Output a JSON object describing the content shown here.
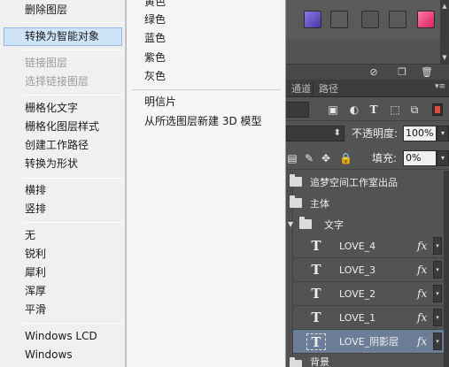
{
  "context_menu": {
    "items": [
      {
        "label": "删除图层",
        "disabled": false
      },
      {
        "label": "转换为智能对象",
        "disabled": false,
        "highlighted": true
      },
      {
        "label": "链接图层",
        "disabled": true
      },
      {
        "label": "选择链接图层",
        "disabled": true
      },
      {
        "label": "栅格化文字",
        "disabled": false
      },
      {
        "label": "栅格化图层样式",
        "disabled": false
      },
      {
        "label": "创建工作路径",
        "disabled": false
      },
      {
        "label": "转换为形状",
        "disabled": false
      },
      {
        "label": "横排",
        "disabled": false
      },
      {
        "label": "竖排",
        "disabled": false
      },
      {
        "label": "无",
        "disabled": false
      },
      {
        "label": "锐利",
        "disabled": false
      },
      {
        "label": "犀利",
        "disabled": false
      },
      {
        "label": "浑厚",
        "disabled": false
      },
      {
        "label": "平滑",
        "disabled": false
      },
      {
        "label": "Windows LCD",
        "disabled": false
      },
      {
        "label": "Windows",
        "disabled": false
      }
    ]
  },
  "submenu": {
    "items": [
      {
        "label": "黄色"
      },
      {
        "label": "绿色"
      },
      {
        "label": "蓝色"
      },
      {
        "label": "紫色"
      },
      {
        "label": "灰色"
      },
      {
        "label": "明信片"
      },
      {
        "label": "从所选图层新建 3D 模型"
      }
    ]
  },
  "panel": {
    "tabs": [
      {
        "label": "通道"
      },
      {
        "label": "路径"
      }
    ],
    "opacity_label": "不透明度:",
    "opacity_value": "100%",
    "fill_label": "填充:",
    "fill_value": "0%",
    "layers": [
      {
        "name": "追梦空间工作室出品",
        "kind": "group"
      },
      {
        "name": "主体",
        "kind": "group"
      },
      {
        "name": "文字",
        "kind": "group-open"
      },
      {
        "name": "LOVE_4",
        "kind": "text",
        "fx": "fx"
      },
      {
        "name": "LOVE_3",
        "kind": "text",
        "fx": "fx"
      },
      {
        "name": "LOVE_2",
        "kind": "text",
        "fx": "fx"
      },
      {
        "name": "LOVE_1",
        "kind": "text",
        "fx": "fx"
      },
      {
        "name": "LOVE_阴影层",
        "kind": "text",
        "fx": "fx",
        "selected": true
      },
      {
        "name": "背景",
        "kind": "group"
      }
    ],
    "text_thumb_glyph": "T",
    "fx_dropdown_glyph": "▾"
  },
  "colors": {
    "menu_bg": "#f0f0f0",
    "highlight_bg": "#cfe3f9",
    "highlight_border": "#93b9e6",
    "panel_bg": "#535353",
    "selected_layer": "#6c7d98",
    "swatch_purple": "#6b5ac8",
    "swatch_pink": "#e8437a"
  }
}
